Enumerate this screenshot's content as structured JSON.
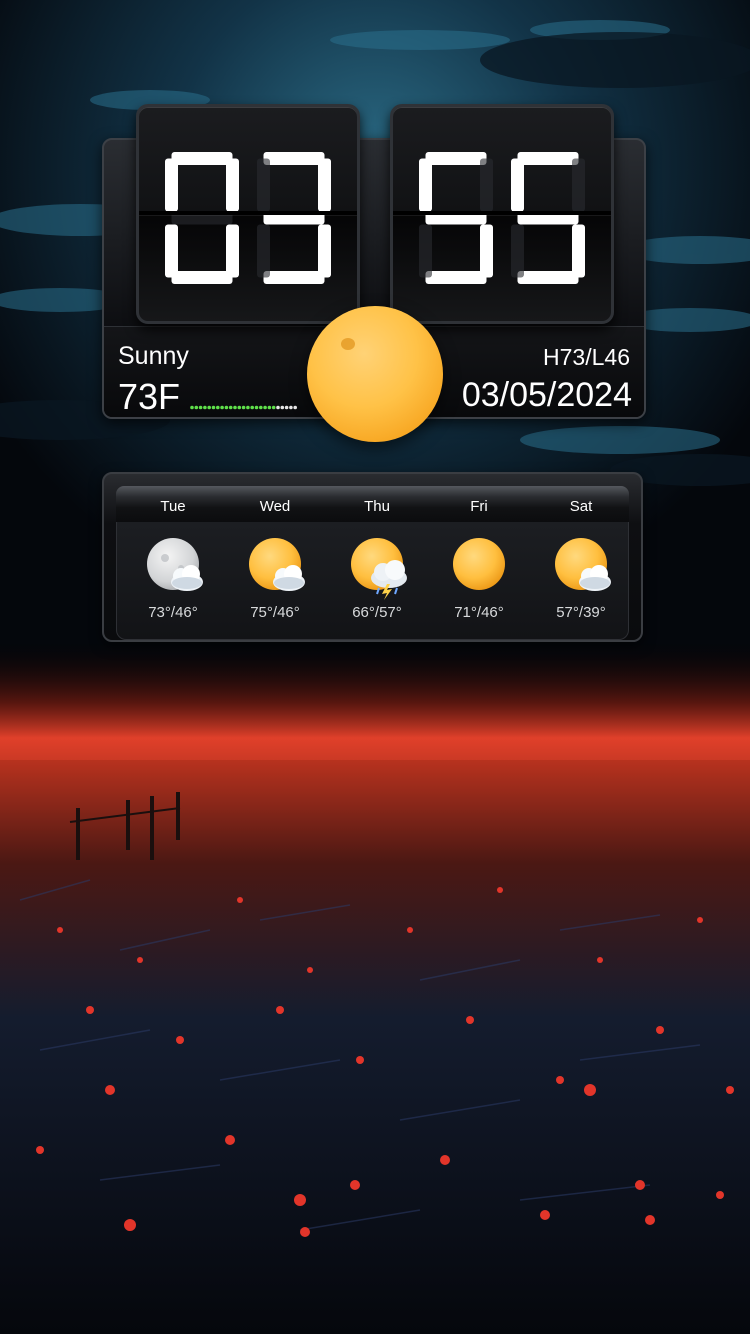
{
  "clock": {
    "hours": "03",
    "minutes": "55"
  },
  "weather": {
    "condition": "Sunny",
    "temperature": "73F",
    "high_low": "H73/L46",
    "date": "03/05/2024",
    "icon": "sun-icon"
  },
  "forecast": [
    {
      "day": "Tue",
      "temps": "73°/46°",
      "icon": "moon-cloud-icon"
    },
    {
      "day": "Wed",
      "temps": "75°/46°",
      "icon": "sun-cloud-icon"
    },
    {
      "day": "Thu",
      "temps": "66°/57°",
      "icon": "sun-storm-cloud-icon"
    },
    {
      "day": "Fri",
      "temps": "71°/46°",
      "icon": "sun-icon"
    },
    {
      "day": "Sat",
      "temps": "57°/39°",
      "icon": "sun-cloud-icon"
    }
  ],
  "colors": {
    "sky": "#1d4f6a",
    "horizon_glow": "#e0402a",
    "sun": "#ffc247",
    "temp_bar_active": "#5fe04a",
    "temp_bar_inactive": "#e6e6e6"
  }
}
